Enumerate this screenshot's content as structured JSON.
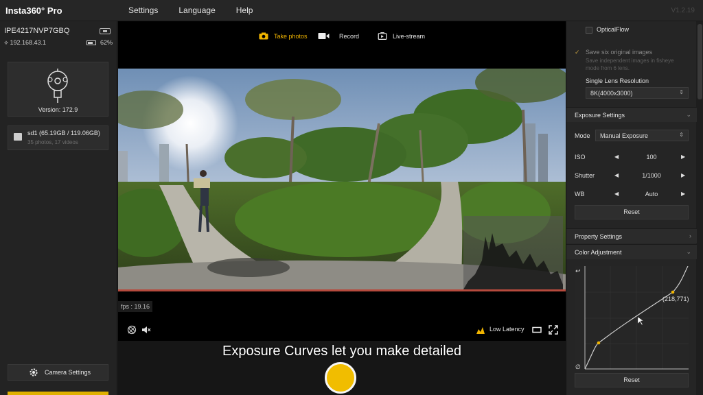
{
  "app": {
    "logo": "Insta360° Pro",
    "version": "V1.2.19",
    "menu": [
      "Settings",
      "Language",
      "Help"
    ]
  },
  "sidebar": {
    "device_id": "IPE4217NVP7GBQ",
    "ip": "192.168.43.1",
    "battery": "62%",
    "battery_level": 0.62,
    "camera_version": "Version:  172.9",
    "storage_title": "sd1 (65.19GB / 119.06GB)",
    "storage_sub": "35 photos, 17 videos",
    "camera_settings": "Camera Settings"
  },
  "modes": {
    "take_photos": "Take photos",
    "record": "Record",
    "live_stream": "Live-stream"
  },
  "preview": {
    "fps": "fps : 19.16",
    "low_latency": "Low Latency"
  },
  "caption": "Exposure Curves let you make detailed",
  "colors": {
    "accent": "#f0b400",
    "panel": "#252525",
    "section": "#2b2b2b"
  },
  "rpanel": {
    "optical_flow": "OpticalFlow",
    "save_six": "Save six original images",
    "save_six_desc_1": "Save independent images in fisheye",
    "save_six_desc_2": "mode from 6 lens.",
    "single_lens_title": "Single Lens Resolution",
    "single_lens_value": "8K(4000x3000)",
    "exposure_settings": "Exposure Settings",
    "mode_label": "Mode",
    "mode_value": "Manual Exposure",
    "iso_label": "ISO",
    "iso_value": "100",
    "shutter_label": "Shutter",
    "shutter_value": "1/1000",
    "wb_label": "WB",
    "wb_value": "Auto",
    "reset": "Reset",
    "property_settings": "Property Settings",
    "color_adjustment": "Color Adjustment",
    "curve_point": "(218,771)",
    "reset2": "Reset"
  }
}
